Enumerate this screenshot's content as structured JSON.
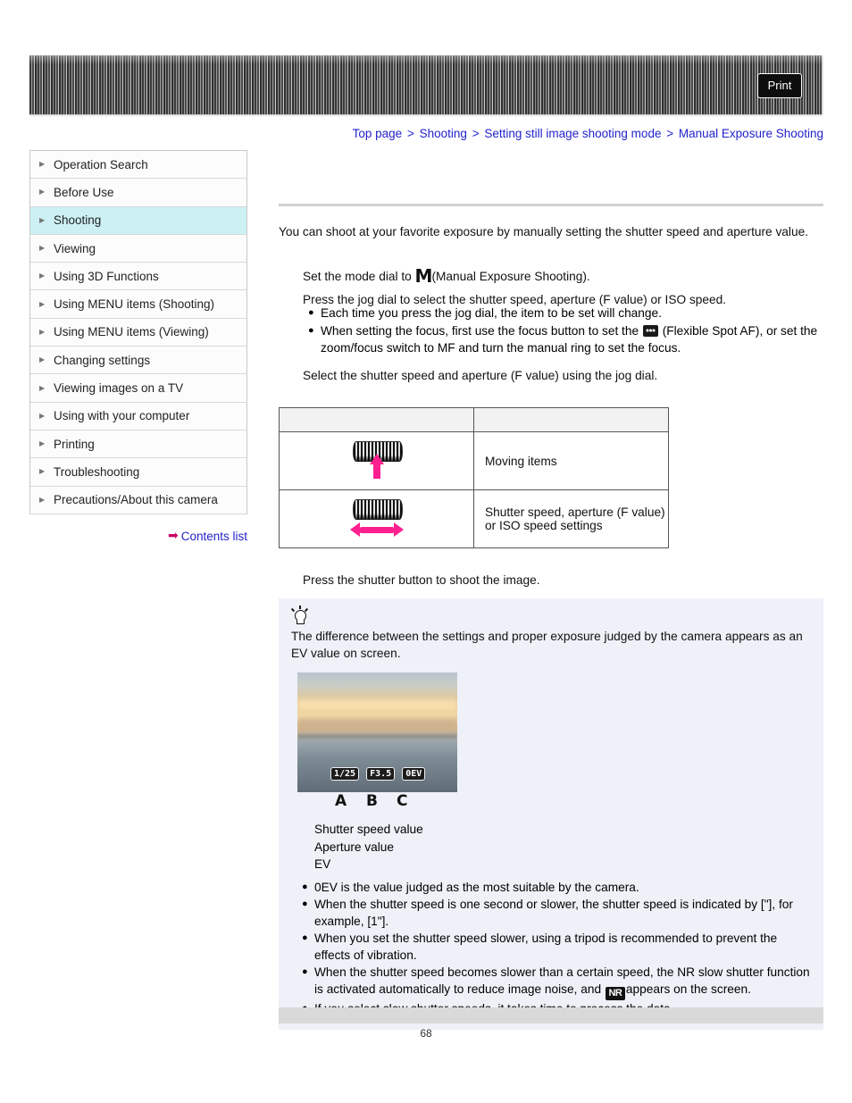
{
  "banner": {
    "print_label": "Print"
  },
  "breadcrumb": {
    "items": [
      "Top page",
      "Shooting",
      "Setting still image shooting mode",
      "Manual Exposure Shooting"
    ],
    "separator": ">"
  },
  "sidebar": {
    "items": [
      {
        "label": "Operation Search",
        "active": false
      },
      {
        "label": "Before Use",
        "active": false
      },
      {
        "label": "Shooting",
        "active": true
      },
      {
        "label": "Viewing",
        "active": false
      },
      {
        "label": "Using 3D Functions",
        "active": false
      },
      {
        "label": "Using MENU items (Shooting)",
        "active": false
      },
      {
        "label": "Using MENU items (Viewing)",
        "active": false
      },
      {
        "label": "Changing settings",
        "active": false
      },
      {
        "label": "Viewing images on a TV",
        "active": false
      },
      {
        "label": "Using with your computer",
        "active": false
      },
      {
        "label": "Printing",
        "active": false
      },
      {
        "label": "Troubleshooting",
        "active": false
      },
      {
        "label": "Precautions/About this camera",
        "active": false
      }
    ],
    "contents_list": "Contents list"
  },
  "main": {
    "intro": "You can shoot at your favorite exposure by manually setting the shutter speed and aperture value.",
    "step1_pre": "Set the mode dial to ",
    "step1_mode_glyph": "M",
    "step1_post": "(Manual Exposure Shooting).",
    "step2": "Press the jog dial to select the shutter speed, aperture (F value) or ISO speed.",
    "bullet1": "Each time you press the jog dial, the item to be set will change.",
    "bullet2_pre": "When setting the focus, first use the focus button to set the ",
    "bullet2_icon": "flexible-spot-af-icon",
    "bullet2_post": "(Flexible Spot AF), or set the zoom/focus switch to MF and turn the manual ring to set the focus.",
    "step3": "Select the shutter speed and aperture (F value) using the jog dial.",
    "step4": "Press the shutter button to shoot the image.",
    "table": {
      "header": [
        "",
        ""
      ],
      "rows": [
        {
          "icon": "jog-dial-press-icon",
          "description": "Moving items"
        },
        {
          "icon": "jog-dial-rotate-icon",
          "description": "Shutter speed, aperture (F value) or ISO speed settings"
        }
      ]
    },
    "hint": {
      "icon": "lightbulb-icon",
      "text": "The difference between the settings and proper exposure judged by the camera appears as an EV value on screen.",
      "photo": {
        "osd": [
          "1/25",
          "F3.5",
          "0EV"
        ],
        "labels": [
          "A",
          "B",
          "C"
        ]
      },
      "legend": [
        "Shutter speed value",
        "Aperture value",
        "EV"
      ],
      "bullets": [
        "0EV is the value judged as the most suitable by the camera.",
        "When the shutter speed is one second or slower, the shutter speed is indicated by [\"], for example, [1\"].",
        "When you set the shutter speed slower, using a tripod is recommended to prevent the effects of vibration.",
        "When the shutter speed becomes slower than a certain speed, the NR slow shutter function is activated automatically to reduce image noise, and",
        "If you select slow shutter speeds, it takes time to process the data."
      ],
      "bullet4_tail": "appears on the screen.",
      "nr_icon_label": "NR"
    }
  },
  "footer": {
    "page_number": "68"
  }
}
